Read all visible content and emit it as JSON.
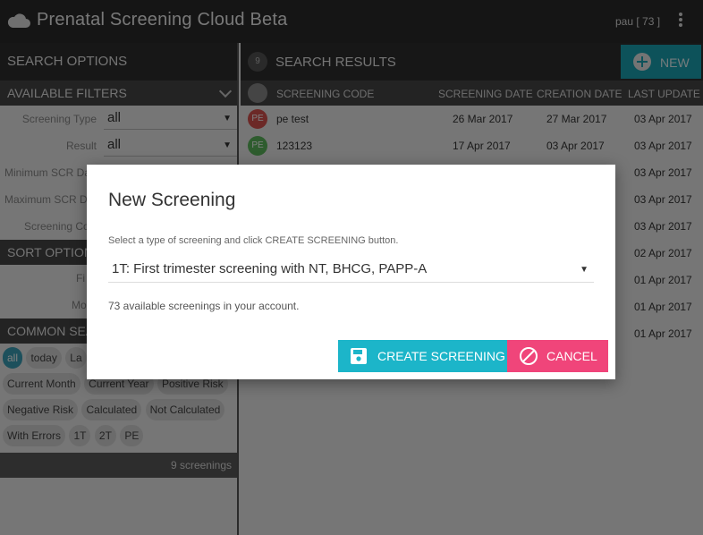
{
  "app": {
    "title": "Prenatal Screening Cloud Beta",
    "user": "pau [ 73 ]"
  },
  "left": {
    "search_options": "SEARCH OPTIONS",
    "available_filters": "AVAILABLE FILTERS",
    "filters": [
      {
        "label": "Screening Type",
        "value": "all"
      },
      {
        "label": "Result",
        "value": "all"
      }
    ],
    "min_scr": "Minimum SCR Da",
    "max_scr": "Maximum SCR Da",
    "screening_code": "Screening Co",
    "sort_options": "SORT OPTION",
    "sort_fi": "Fi",
    "sort_mo": "Mo",
    "common_searches": "COMMON SEA",
    "chips_row1": [
      "all",
      "today",
      "La"
    ],
    "chips_row2": [
      "Current Month",
      "Current Year",
      "Positive Risk"
    ],
    "chips_row3": [
      "Negative Risk",
      "Calculated",
      "Not Calculated"
    ],
    "chips_row4": [
      "With Errors",
      "1T",
      "2T",
      "PE"
    ],
    "counter": "9 screenings"
  },
  "right": {
    "count": "9",
    "title": "SEARCH RESULTS",
    "new_label": "NEW",
    "columns": [
      "SCREENING CODE",
      "SCREENING DATE",
      "CREATION DATE",
      "LAST UPDATE"
    ],
    "rows": [
      {
        "badge": "PE",
        "badge_color": "#d9534f",
        "code": "pe test",
        "scr_date": "26 Mar 2017",
        "created": "27 Mar 2017",
        "updated": "03 Apr 2017"
      },
      {
        "badge": "PE",
        "badge_color": "#5cb85c",
        "code": "123123",
        "scr_date": "17 Apr 2017",
        "created": "03 Apr 2017",
        "updated": "03 Apr 2017"
      },
      {
        "badge": "",
        "badge_color": "",
        "code": "",
        "scr_date": "",
        "created": "",
        "updated": "03 Apr 2017"
      },
      {
        "badge": "",
        "badge_color": "",
        "code": "",
        "scr_date": "",
        "created": "",
        "updated": "03 Apr 2017"
      },
      {
        "badge": "",
        "badge_color": "",
        "code": "",
        "scr_date": "",
        "created": "",
        "updated": "03 Apr 2017"
      },
      {
        "badge": "",
        "badge_color": "",
        "code": "",
        "scr_date": "",
        "created": "",
        "updated": "02 Apr 2017"
      },
      {
        "badge": "",
        "badge_color": "",
        "code": "",
        "scr_date": "",
        "created": "",
        "updated": "01 Apr 2017"
      },
      {
        "badge": "",
        "badge_color": "",
        "code": "",
        "scr_date": "",
        "created": "",
        "updated": "01 Apr 2017"
      },
      {
        "badge": "",
        "badge_color": "",
        "code": "",
        "scr_date": "",
        "created": "",
        "updated": "01 Apr 2017"
      }
    ]
  },
  "dialog": {
    "title": "New Screening",
    "hint": "Select a type of screening and click CREATE SCREENING button.",
    "selected_type": "1T: First trimester screening with NT, BHCG, PAPP-A",
    "available": "73 available screenings in your account.",
    "create_label": "CREATE SCREENING",
    "cancel_label": "CANCEL"
  },
  "colors": {
    "accent": "#1cb5c9",
    "cancel": "#f0457a",
    "chip_active": "#3aa0b8"
  }
}
